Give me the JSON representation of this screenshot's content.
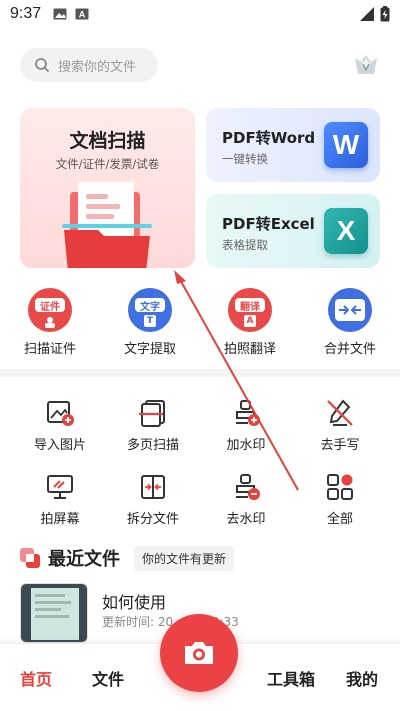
{
  "status_bar": {
    "time": "9:37"
  },
  "search": {
    "placeholder": "搜索你的文件"
  },
  "scan_card": {
    "title": "文档扫描",
    "subtitle": "文件/证件/发票/试卷"
  },
  "pdf_word": {
    "title": "PDF转Word",
    "subtitle": "一键转换",
    "logo_letter": "W"
  },
  "pdf_excel": {
    "title": "PDF转Excel",
    "subtitle": "表格提取",
    "logo_letter": "X"
  },
  "features": [
    {
      "label": "扫描证件",
      "tag": "证件",
      "icon": "id-card-scan-icon",
      "color": "#e84a4a"
    },
    {
      "label": "文字提取",
      "tag": "文字",
      "sub": "T",
      "icon": "text-extract-icon",
      "color": "#3f6fe0"
    },
    {
      "label": "拍照翻译",
      "tag": "翻译",
      "sub": "A",
      "icon": "photo-translate-icon",
      "color": "#e84a4a"
    },
    {
      "label": "合并文件",
      "icon": "merge-files-icon",
      "color": "#3f6fe0"
    }
  ],
  "tools": [
    {
      "label": "导入图片",
      "icon": "import-image-icon"
    },
    {
      "label": "多页扫描",
      "icon": "multi-page-scan-icon"
    },
    {
      "label": "加水印",
      "icon": "add-watermark-icon"
    },
    {
      "label": "去手写",
      "icon": "remove-handwriting-icon"
    },
    {
      "label": "拍屏幕",
      "icon": "screen-capture-icon"
    },
    {
      "label": "拆分文件",
      "icon": "split-file-icon"
    },
    {
      "label": "去水印",
      "icon": "remove-watermark-icon"
    },
    {
      "label": "全部",
      "icon": "all-tools-icon"
    }
  ],
  "recent": {
    "title": "最近文件",
    "badge": "你的文件有更新",
    "files": [
      {
        "name": "如何使用",
        "updated": "更新时间: 20…22 09:33"
      }
    ]
  },
  "nav": {
    "home": "首页",
    "files": "文件",
    "toolbox": "工具箱",
    "mine": "我的"
  },
  "colors": {
    "accent": "#e8423f",
    "annotation_arrow": "#e0443c"
  }
}
